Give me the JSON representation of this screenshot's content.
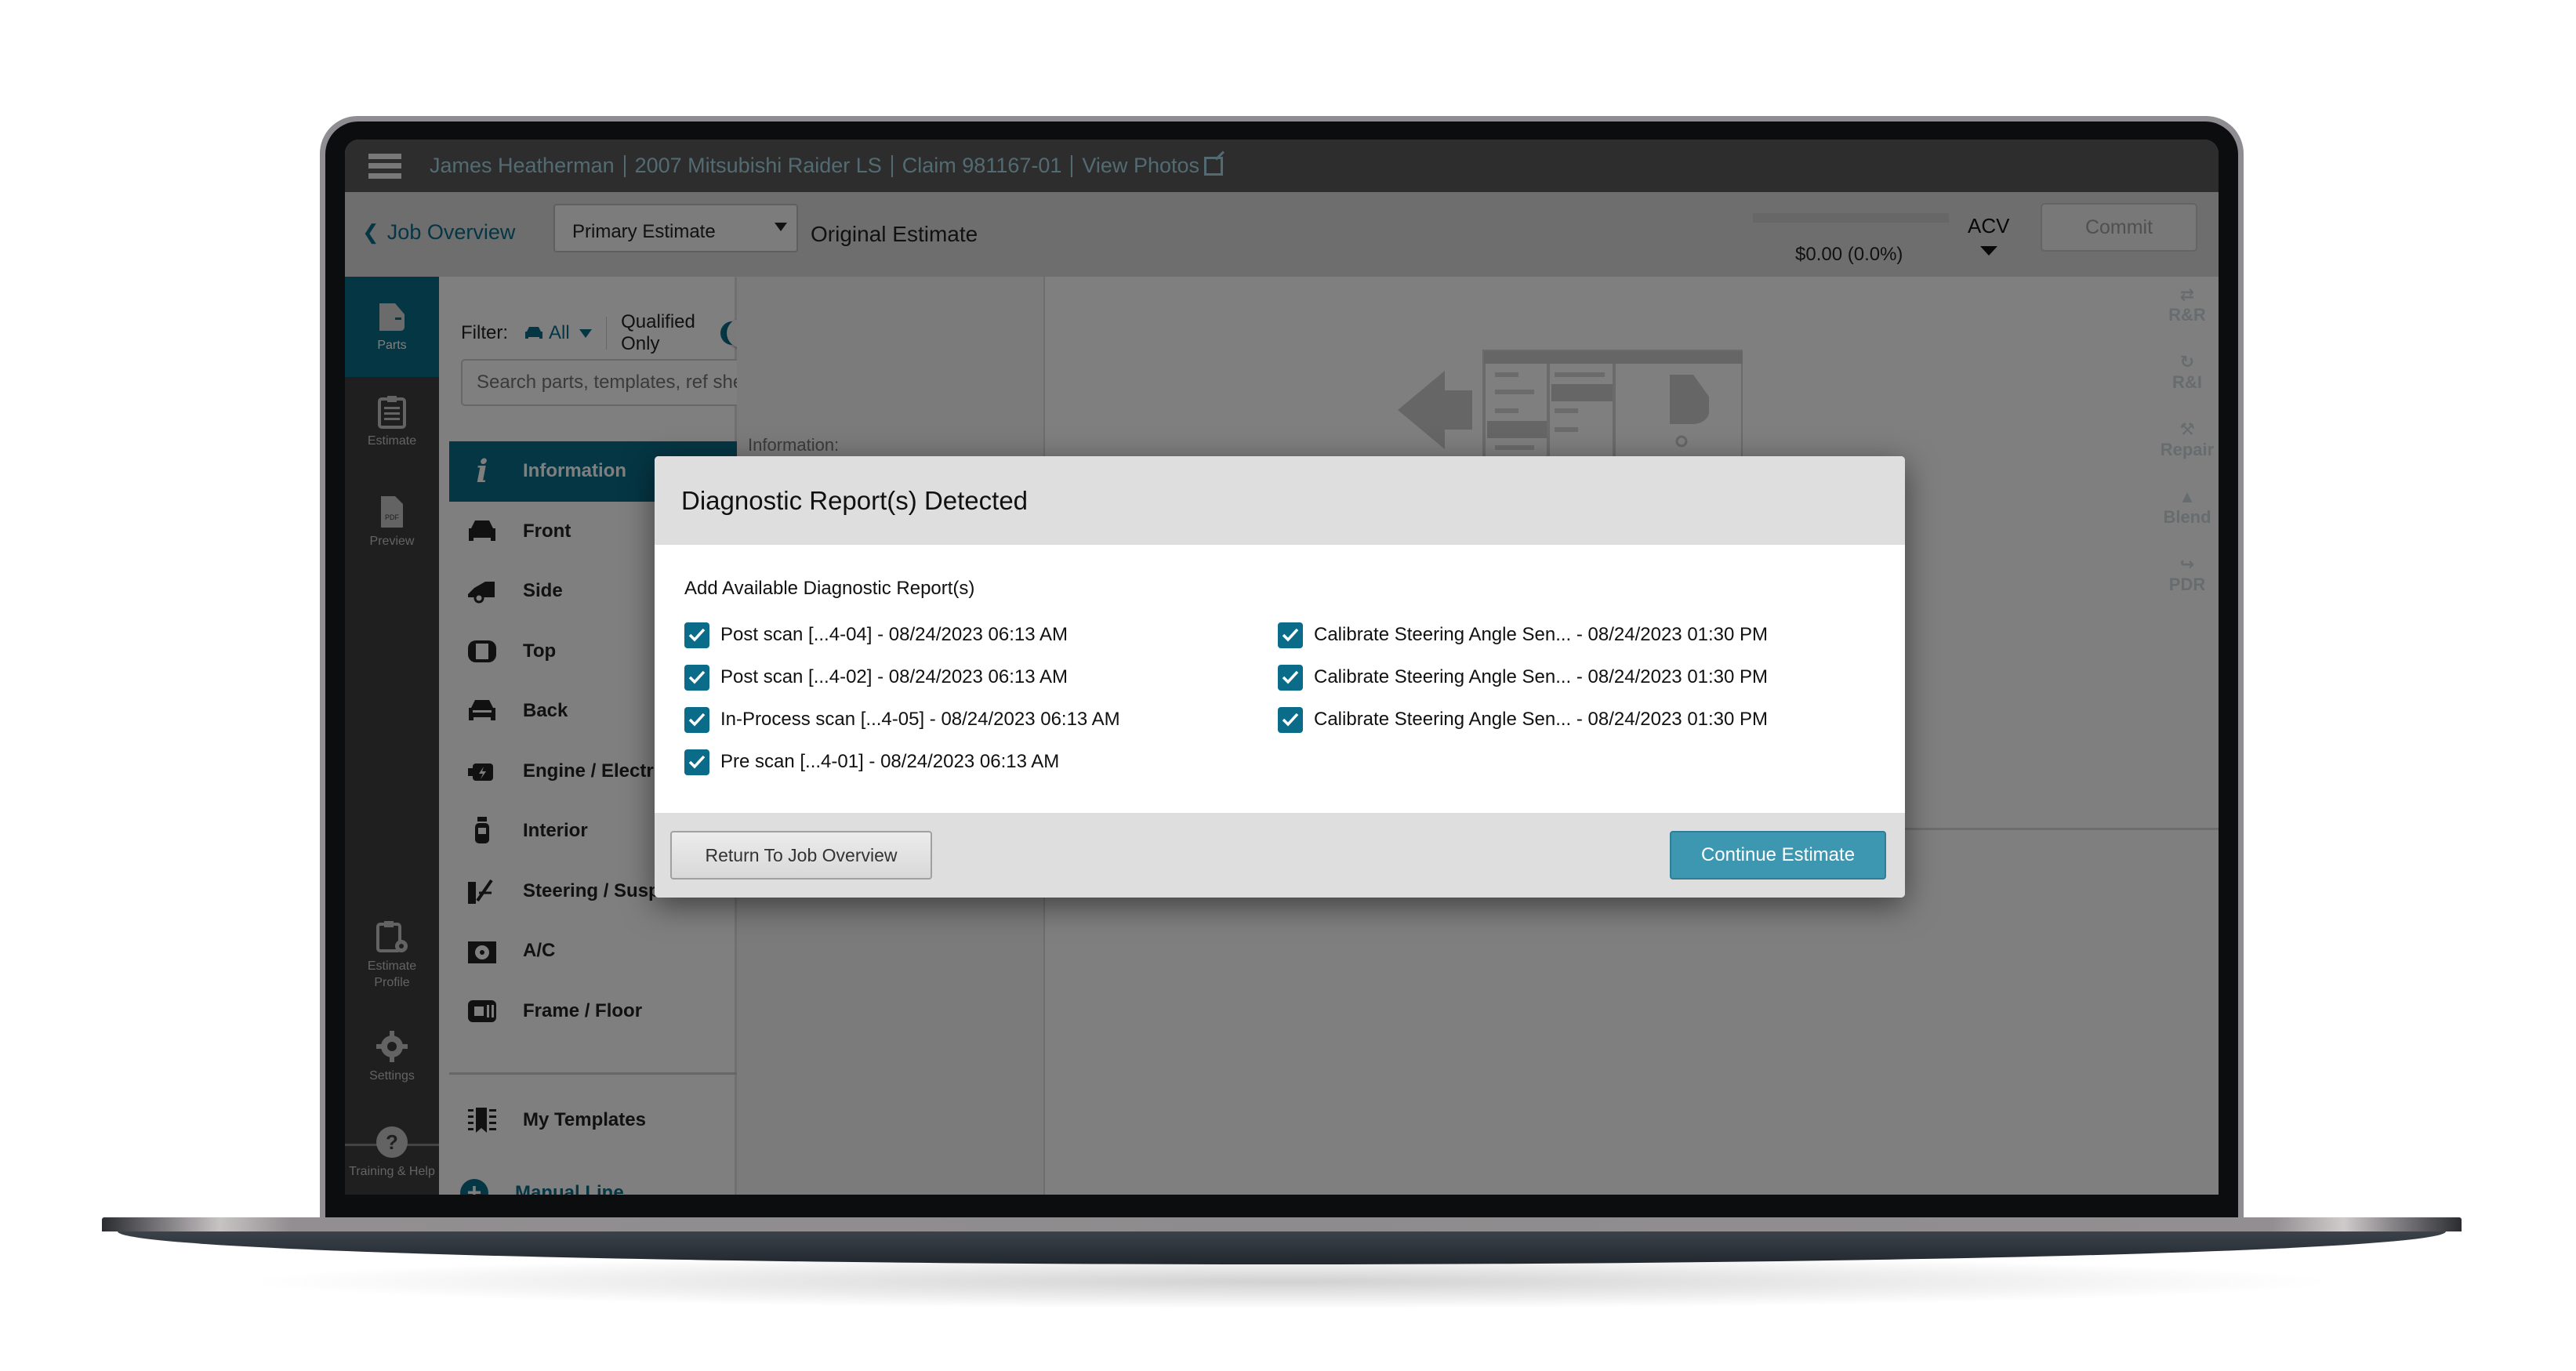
{
  "header": {
    "menu_icon": "hamburger-icon",
    "breadcrumb": [
      "James Heatherman",
      "2007 Mitsubishi Raider LS",
      "Claim 981167-01"
    ],
    "view_photos": "View Photos",
    "view_photos_icon": "external-link-icon"
  },
  "subheader": {
    "back_label": "Job Overview",
    "estimate_select": "Primary Estimate",
    "estimate_title": "Original Estimate",
    "amount": "$0.00 (0.0%)",
    "progress_percent": 0,
    "acv_label": "ACV",
    "commit_label": "Commit"
  },
  "rail": {
    "items": [
      {
        "label": "Parts",
        "icon": "car-door-icon",
        "active": true
      },
      {
        "label": "Estimate",
        "icon": "clipboard-icon"
      },
      {
        "label": "Preview",
        "icon": "pdf-file-icon",
        "badge": "PDF"
      },
      {
        "label": "Estimate Profile",
        "icon": "clipboard-gear-icon"
      },
      {
        "label": "Settings",
        "icon": "gear-icon"
      },
      {
        "label": "Training & Help",
        "icon": "help-icon"
      }
    ]
  },
  "parts": {
    "filter_label": "Filter:",
    "filter_value": "All",
    "qualified_only": "Qualified Only",
    "qualified_only_on": true,
    "search_placeholder": "Search parts, templates, ref sheet",
    "categories": [
      {
        "label": "Information",
        "icon": "info-icon",
        "active": true
      },
      {
        "label": "Front",
        "icon": "car-front-icon"
      },
      {
        "label": "Side",
        "icon": "car-side-icon"
      },
      {
        "label": "Top",
        "icon": "car-top-icon"
      },
      {
        "label": "Back",
        "icon": "car-back-icon"
      },
      {
        "label": "Engine / Electrical",
        "icon": "engine-icon"
      },
      {
        "label": "Interior",
        "icon": "seat-icon"
      },
      {
        "label": "Steering / Suspension",
        "icon": "suspension-icon"
      },
      {
        "label": "A/C",
        "icon": "fan-icon"
      },
      {
        "label": "Frame / Floor",
        "icon": "frame-icon"
      }
    ],
    "my_templates": "My Templates",
    "manual_line": "Manual Line"
  },
  "info_panel": {
    "label": "Information:"
  },
  "tools": [
    "R&R",
    "R&I",
    "Repair",
    "Blend",
    "PDR"
  ],
  "modal": {
    "title": "Diagnostic Report(s) Detected",
    "subtitle": "Add Available Diagnostic Report(s)",
    "reports_left": [
      {
        "label": "Post scan [...4-04] - 08/24/2023 06:13 AM",
        "checked": true
      },
      {
        "label": "Post scan [...4-02] - 08/24/2023 06:13 AM",
        "checked": true
      },
      {
        "label": "In-Process scan [...4-05] - 08/24/2023 06:13 AM",
        "checked": true
      },
      {
        "label": "Pre scan [...4-01] - 08/24/2023 06:13 AM",
        "checked": true
      }
    ],
    "reports_right": [
      {
        "label": "Calibrate Steering Angle Sen... - 08/24/2023 01:30 PM",
        "checked": true
      },
      {
        "label": "Calibrate Steering Angle Sen... - 08/24/2023 01:30 PM",
        "checked": true
      },
      {
        "label": "Calibrate Steering Angle Sen... - 08/24/2023 01:30 PM",
        "checked": true
      }
    ],
    "return_label": "Return To Job Overview",
    "continue_label": "Continue Estimate"
  },
  "colors": {
    "accent": "#0a6c89",
    "button_primary": "#3d97b1",
    "link": "#a5d6e4"
  }
}
